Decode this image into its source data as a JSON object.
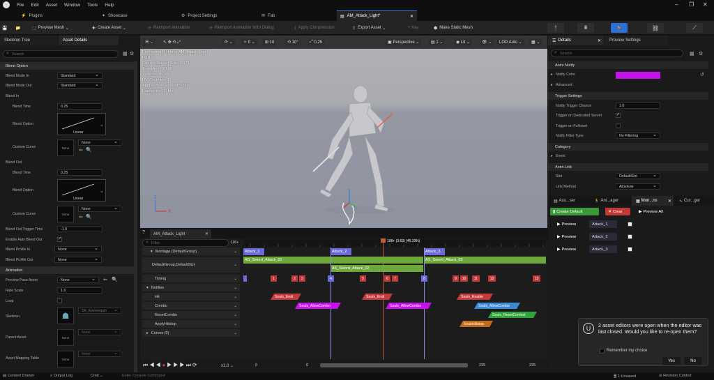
{
  "menu": [
    "File",
    "Edit",
    "Asset",
    "Window",
    "Tools",
    "Help"
  ],
  "tabs": {
    "plugins": "Plugins",
    "showcase": "Showcase",
    "project_settings": "Project Settings",
    "fab": "Fab",
    "asset": "AM_Attack_Light*"
  },
  "toolbar": {
    "preview_mesh": "Preview Mesh",
    "create_asset": "Create Asset",
    "reimport": "Reimport Animation",
    "reimport_dialog": "Reimport Animation With Dialog",
    "apply_compression": "Apply Compression",
    "export_asset": "Export Asset",
    "key": "+ Key",
    "make_static": "Make Static Mesh"
  },
  "left": {
    "tab_skeleton": "Skeleton Tree",
    "tab_details": "Asset Details",
    "search": "Search",
    "blend_option_cat": "Blend Option",
    "blend_mode_in": "Blend Mode In",
    "blend_mode_in_val": "Standard",
    "blend_mode_out": "Blend Mode Out",
    "blend_mode_out_val": "Standard",
    "blend_in": "Blend In",
    "blend_time": "Blend Time",
    "blend_in_time_val": "0.25",
    "blend_option": "Blend Option",
    "linear": "Linear",
    "custom_curve": "Custom Curve",
    "none": "None",
    "blend_out": "Blend Out",
    "blend_out_time_val": "0.25",
    "blend_out_trigger": "Blend Out Trigger Time",
    "blend_out_trigger_val": "-1.0",
    "enable_auto": "Enable Auto Blend Out",
    "blend_profile_in": "Blend Profile In",
    "blend_profile_out": "Blend Profile Out",
    "animation_cat": "Animation",
    "preview_pose": "Preview Pose Asset",
    "rate_scale": "Rate Scale",
    "rate_scale_val": "1.0",
    "loop": "Loop",
    "skeleton": "Skeleton",
    "skeleton_val": "SK_Mannequin",
    "parent_asset": "Parent Asset",
    "asset_mapping": "Asset Mapping Table"
  },
  "viewport": {
    "perspective": "Perspective",
    "lit": "Lit",
    "lod": "LOD Auto",
    "snap1": "10",
    "snap2": "10°",
    "snap3": "0.25",
    "stats": [
      "Previewing Montage AM_Attack_Light",
      "LOD: 0",
      "Current Screen Size: 1.075",
      "Triangles: 87,690",
      "Vertices: 45,908",
      "UV Channels: 1",
      "Approx Size: 109x185x167",
      "Framerate: 30 fps"
    ]
  },
  "montage": {
    "tab": "AM_Attack_Light",
    "filter": "Filter",
    "playhead": "108+ (3.63) (46.33%)",
    "tracks": {
      "montage": "Montage (DefaultGroup)",
      "slot": "DefaultGroup.DefaultSlot",
      "timing": "Timing",
      "notifies": "Notifies",
      "hit": "Hit",
      "combo": "Combo",
      "reset": "ResetCombo",
      "hitstop": "ApplyHitstop",
      "curves": "Curves (0)"
    },
    "sections": [
      "Attack_1",
      "Attack_2",
      "Attack_3"
    ],
    "segments": [
      "AS_Sword_Attack_01",
      "AS_Sword_Attack_02",
      "AS_Sword_Attack_03"
    ],
    "markers": [
      "1",
      "2",
      "3",
      "4",
      "5",
      "6",
      "7",
      "8",
      "9",
      "10",
      "11",
      "12",
      "13"
    ],
    "notifies": {
      "hit": [
        "Souls_Endi",
        "Souls_Endi",
        "Souls_Enable"
      ],
      "combo": [
        "Souls_AllowCombo",
        "Souls_AllowCombo",
        "Souls_AllowCombo"
      ],
      "reset": "Souls_ResetCombat",
      "hitstop": "SoulsHitstop"
    },
    "transport": {
      "speed": "x1.0",
      "frame_start": "0",
      "frame_cur": "0",
      "frame_end": "235",
      "frame_total": "235"
    },
    "ruler": "100+"
  },
  "right": {
    "tab_details": "Details",
    "tab_preview": "Preview Settings",
    "search": "Search",
    "anim_notify": "Anim Notify",
    "notify_color": "Notify Color",
    "notify_color_hex": "#c512ec",
    "advanced": "Advanced",
    "trigger_settings": "Trigger Settings",
    "trigger_chance": "Notify Trigger Chance",
    "trigger_chance_val": "1.0",
    "trigger_dedicated": "Trigger on Dedicated Server",
    "trigger_follower": "Trigger on Follower",
    "filter_type": "Notify Filter Type",
    "filter_val": "No Filtering",
    "category": "Category",
    "event": "Event",
    "anim_link": "Anim Link",
    "slot": "Slot",
    "slot_val": "DefaultSlot",
    "link_method": "Link Method",
    "link_val": "Absolute",
    "bottom_tabs": [
      "Ass...ser",
      "Ani...ager",
      "Mon...ns",
      "Cur...ger"
    ],
    "create_default": "Create Default",
    "clear": "Clear",
    "preview_all": "Preview All",
    "preview": "Preview"
  },
  "toast": {
    "text": "2 asset editors were open when the editor was last closed. Would you like to re-open them?",
    "remember": "Remember my choice",
    "yes": "Yes",
    "no": "No"
  },
  "status": {
    "content_drawer": "Content Drawer",
    "output_log": "Output Log",
    "cmd": "Cmd",
    "console": "Enter Console Command",
    "unsaved": "1 Unsaved",
    "revision": "Revision Control"
  }
}
